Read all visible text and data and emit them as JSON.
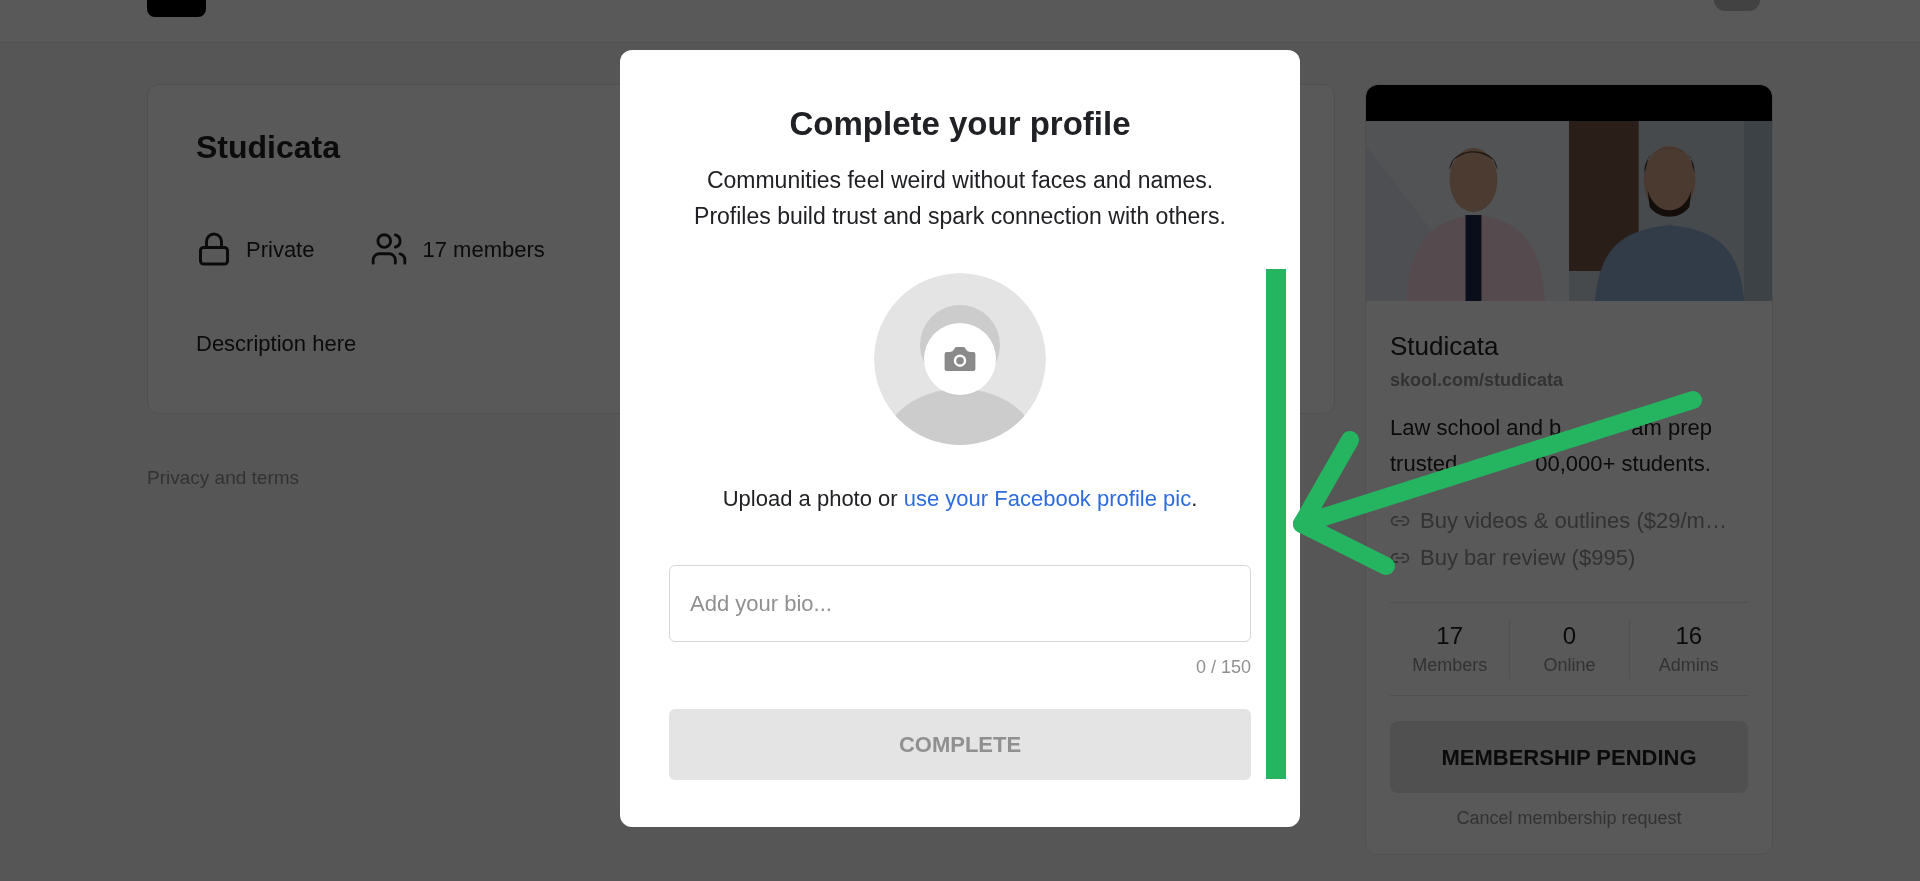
{
  "group": {
    "title": "Studicata",
    "meta": [
      {
        "kind": "privacy",
        "label": "Private"
      },
      {
        "kind": "members",
        "label": "17 members"
      }
    ],
    "description": "Description here"
  },
  "footer": {
    "link": "Privacy and terms"
  },
  "sidebar": {
    "title": "Studicata",
    "url": "skool.com/studicata",
    "description_lines": [
      [
        "Law school and b",
        "am prep"
      ],
      [
        "trusted",
        "00,000+ students."
      ]
    ],
    "links": [
      {
        "label": "Buy videos & outlines ($29/m…"
      },
      {
        "label": "Buy bar review ($995)"
      }
    ],
    "stats": [
      {
        "value": "17",
        "label": "Members"
      },
      {
        "value": "0",
        "label": "Online"
      },
      {
        "value": "16",
        "label": "Admins"
      }
    ],
    "button": {
      "label": "MEMBERSHIP PENDING"
    },
    "cancel_link": "Cancel membership request"
  },
  "modal": {
    "title": "Complete your profile",
    "subtitle": [
      "Communities feel weird without faces and names.",
      "Profiles build trust and spark connection with others."
    ],
    "upload_prompt": {
      "text": "Upload a photo or",
      "link": "use your Facebook profile pic",
      "after": "."
    },
    "bio": {
      "placeholder": "Add your bio...",
      "counter": "0 / 150"
    },
    "button": {
      "label": "COMPLETE",
      "disabled": true
    }
  }
}
